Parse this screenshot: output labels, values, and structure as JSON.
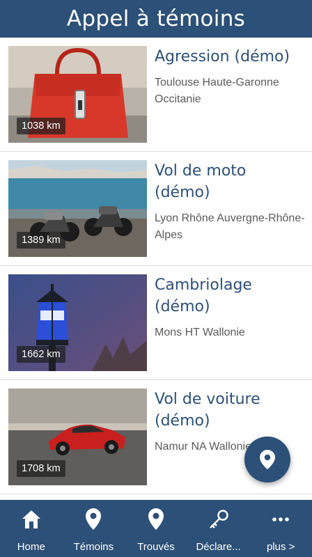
{
  "header": {
    "title": "Appel à témoins"
  },
  "cards": [
    {
      "title": "Agression (démo)",
      "location": "Toulouse Haute-Garonne Occitanie",
      "distance": "1038 km",
      "image": "red-handbag"
    },
    {
      "title": "Vol de moto (démo)",
      "location": "Lyon Rhône Auvergne-Rhône-Alpes",
      "distance": "1389 km",
      "image": "motorcycles-seaside"
    },
    {
      "title": "Cambriolage (démo)",
      "location": "Mons HT Wallonie",
      "distance": "1662 km",
      "image": "police-lamp"
    },
    {
      "title": "Vol de voiture (démo)",
      "location": "Namur NA Wallonie",
      "distance": "1708 km",
      "image": "red-sports-car"
    }
  ],
  "fab": {
    "icon": "map-pin-icon"
  },
  "nav": {
    "items": [
      {
        "label": "Home",
        "icon": "home-icon"
      },
      {
        "label": "Témoins",
        "icon": "map-pin-icon"
      },
      {
        "label": "Trouvés",
        "icon": "map-pin-icon"
      },
      {
        "label": "Déclare...",
        "icon": "key-icon"
      },
      {
        "label": "plus >",
        "icon": "more-dots-icon"
      }
    ]
  },
  "colors": {
    "primary": "#2c5077",
    "text_secondary": "#5a5a5a",
    "divider": "#dcdcdc"
  }
}
